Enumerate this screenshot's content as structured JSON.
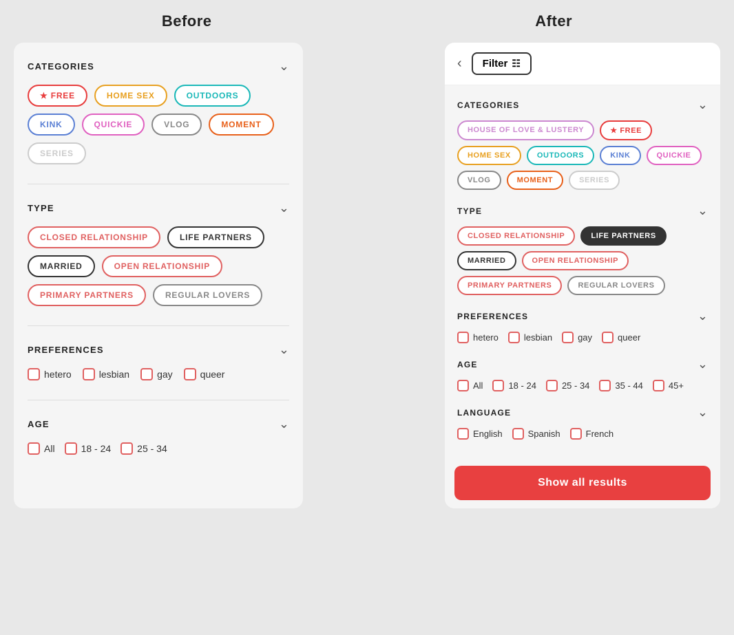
{
  "headers": {
    "before": "Before",
    "after": "After"
  },
  "before": {
    "categories": {
      "title": "CATEGORIES",
      "tags": [
        {
          "label": "★ FREE",
          "class": "tag-free"
        },
        {
          "label": "HOME SEX",
          "class": "tag-homesex"
        },
        {
          "label": "OUTDOORS",
          "class": "tag-outdoors"
        },
        {
          "label": "KINK",
          "class": "tag-kink"
        },
        {
          "label": "QUICKIE",
          "class": "tag-quickie"
        },
        {
          "label": "VLOG",
          "class": "tag-vlog"
        },
        {
          "label": "MOMENT",
          "class": "tag-moment"
        },
        {
          "label": "SERIES",
          "class": "tag-series"
        }
      ]
    },
    "type": {
      "title": "TYPE",
      "tags": [
        {
          "label": "CLOSED RELATIONSHIP",
          "class": "tag-closed"
        },
        {
          "label": "LIFE PARTNERS",
          "class": "tag-lifepartners"
        },
        {
          "label": "MARRIED",
          "class": "tag-married"
        },
        {
          "label": "OPEN RELATIONSHIP",
          "class": "tag-open"
        },
        {
          "label": "PRIMARY PARTNERS",
          "class": "tag-primary"
        },
        {
          "label": "REGULAR LOVERS",
          "class": "tag-regularlovers"
        }
      ]
    },
    "preferences": {
      "title": "PREFERENCES",
      "items": [
        "hetero",
        "lesbian",
        "gay",
        "queer"
      ]
    },
    "age": {
      "title": "AGE",
      "items": [
        "All",
        "18 - 24",
        "25 - 34"
      ]
    }
  },
  "after": {
    "filter_button": "Filter",
    "categories": {
      "title": "CATEGORIES",
      "tags": [
        {
          "label": "House of Love & Lustery",
          "class": "after-tag-house"
        },
        {
          "label": "★ FREE",
          "class": "after-tag-free"
        },
        {
          "label": "HOME SEX",
          "class": "after-tag-homesex"
        },
        {
          "label": "OUTDOORS",
          "class": "after-tag-outdoors"
        },
        {
          "label": "KINK",
          "class": "after-tag-kink"
        },
        {
          "label": "QUICKIE",
          "class": "after-tag-quickie"
        },
        {
          "label": "VLOG",
          "class": "after-tag-vlog"
        },
        {
          "label": "MOMENT",
          "class": "after-tag-moment"
        },
        {
          "label": "SERIES",
          "class": "after-tag-series"
        }
      ]
    },
    "type": {
      "title": "TYPE",
      "tags": [
        {
          "label": "CLOSED RELATIONSHIP",
          "class": "after-tag-closed"
        },
        {
          "label": "LIFE PARTNERS",
          "class": "after-tag-lifepartners"
        },
        {
          "label": "MARRIED",
          "class": "after-tag-married"
        },
        {
          "label": "OPEN RELATIONSHIP",
          "class": "after-tag-open"
        },
        {
          "label": "PRIMARY PARTNERS",
          "class": "after-tag-primary"
        },
        {
          "label": "REGULAR LOVERS",
          "class": "after-tag-regularlovers"
        }
      ]
    },
    "preferences": {
      "title": "PREFERENCES",
      "items": [
        "hetero",
        "lesbian",
        "gay",
        "queer"
      ]
    },
    "age": {
      "title": "AGE",
      "items": [
        "All",
        "18 - 24",
        "25 - 34",
        "35 - 44",
        "45+"
      ]
    },
    "language": {
      "title": "LANGUAGE",
      "items": [
        "English",
        "Spanish",
        "French"
      ]
    },
    "show_results_btn": "Show all results"
  }
}
